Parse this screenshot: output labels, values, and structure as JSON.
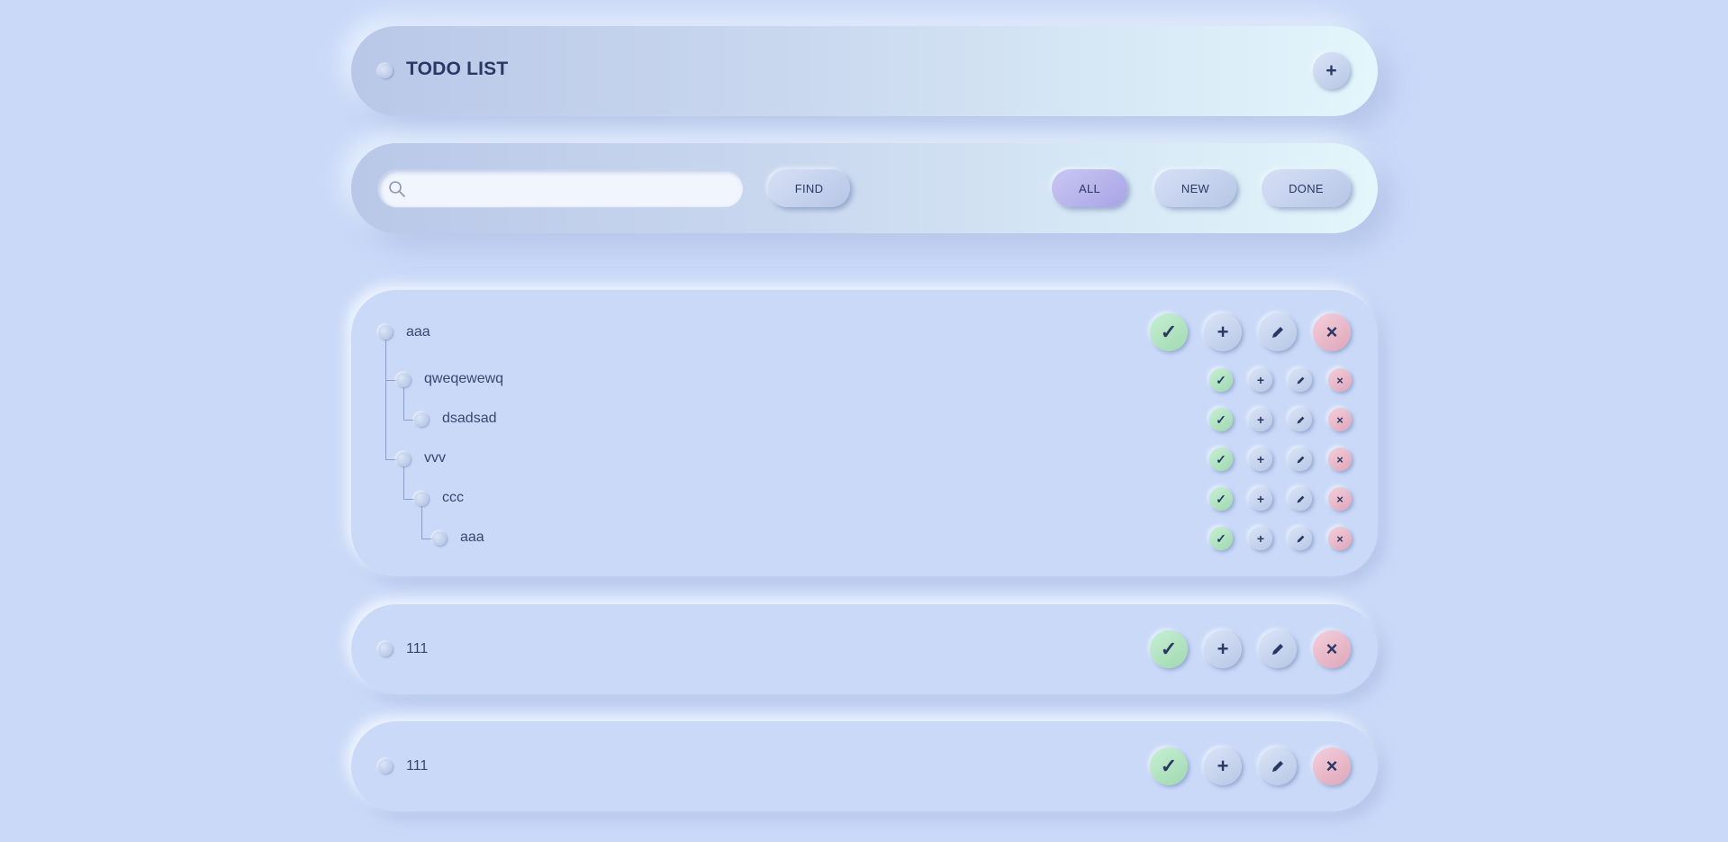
{
  "header": {
    "title": "TODO LIST",
    "add_label": "+"
  },
  "toolbar": {
    "search_placeholder": "",
    "search_value": "",
    "find_label": "FIND",
    "filters": [
      "ALL",
      "NEW",
      "DONE"
    ],
    "active_filter": "ALL"
  },
  "actions": {
    "done": "✓",
    "add": "+",
    "edit_icon": "pencil-icon",
    "delete": "×"
  },
  "groups": [
    {
      "items": [
        {
          "label": "aaa",
          "depth": 0
        },
        {
          "label": "qweqewewq",
          "depth": 1
        },
        {
          "label": "dsadsad",
          "depth": 2
        },
        {
          "label": "vvv",
          "depth": 1
        },
        {
          "label": "ccc",
          "depth": 2
        },
        {
          "label": "aaa",
          "depth": 3
        }
      ]
    },
    {
      "items": [
        {
          "label": "111",
          "depth": 0
        }
      ]
    },
    {
      "items": [
        {
          "label": "111",
          "depth": 0
        }
      ]
    }
  ],
  "colors": {
    "background": "#cad9f8",
    "done_button": "#b4e6c3",
    "delete_button": "#eab9c9",
    "active_filter": "#b8b5ec",
    "text": "#2b3864"
  }
}
